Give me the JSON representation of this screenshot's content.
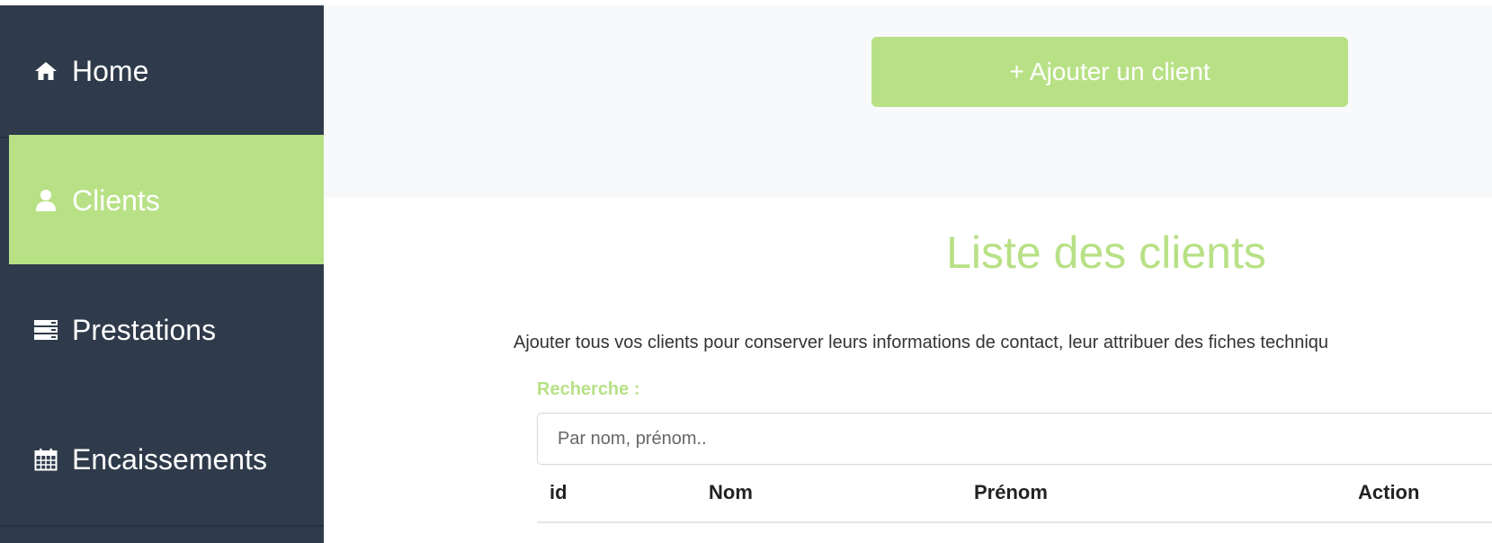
{
  "sidebar": {
    "items": [
      {
        "label": "Home",
        "icon": "home-icon"
      },
      {
        "label": "Clients",
        "icon": "user-icon",
        "active": true
      },
      {
        "label": "Prestations",
        "icon": "list-icon"
      },
      {
        "label": "Encaissements",
        "icon": "calendar-icon"
      }
    ]
  },
  "header": {
    "add_client_label": "+ Ajouter un client"
  },
  "main": {
    "title": "Liste des clients",
    "description": "Ajouter tous vos clients pour conserver leurs informations de contact, leur attribuer des fiches techniqu",
    "search": {
      "label": "Recherche :",
      "placeholder": "Par nom, prénom..",
      "value": ""
    },
    "table": {
      "headers": [
        "id",
        "Nom",
        "Prénom",
        "Action"
      ]
    }
  },
  "colors": {
    "accent": "#b8e186",
    "sidebar": "#2f3b4b"
  }
}
